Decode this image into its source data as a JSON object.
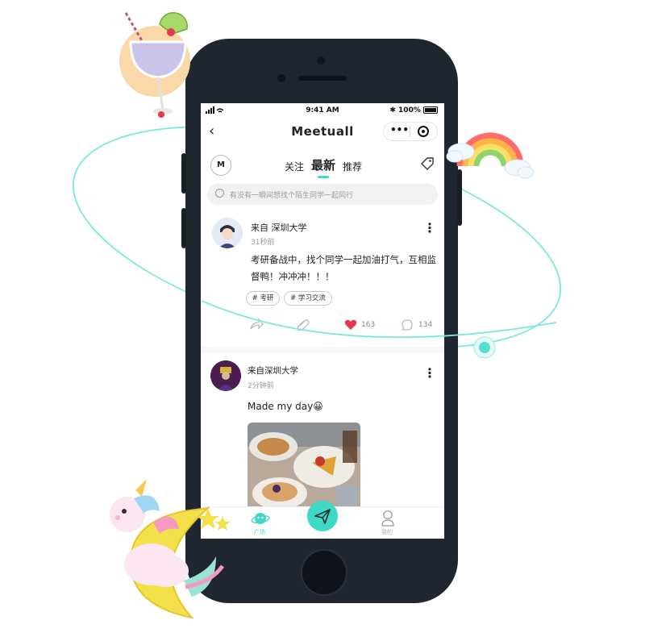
{
  "status_bar": {
    "time": "9:41 AM",
    "battery": "100%"
  },
  "app": {
    "logo": "Meetuall"
  },
  "tabs": {
    "follow": "关注",
    "latest": "最新",
    "recommend": "推荐"
  },
  "search": {
    "placeholder": "有没有一瞬间想找个陌生同学一起同行"
  },
  "posts": [
    {
      "author": "来自 深圳大学",
      "time": "31秒前",
      "text_line1": "考研备战中，找个同学一起加油打气，互相监",
      "text_line2": "督鸭！冲冲冲！！！",
      "tags": [
        "# 考研",
        "# 学习交流"
      ],
      "likes": "163",
      "comments": "134"
    },
    {
      "author": "来自深圳大学",
      "time": "2分钟前",
      "text": "Made my day😀"
    }
  ],
  "tabbar": {
    "plaza": "广场",
    "mine": "我的"
  },
  "colors": {
    "accent": "#3fd8c5",
    "phone": "#202630",
    "like": "#e8364f"
  }
}
